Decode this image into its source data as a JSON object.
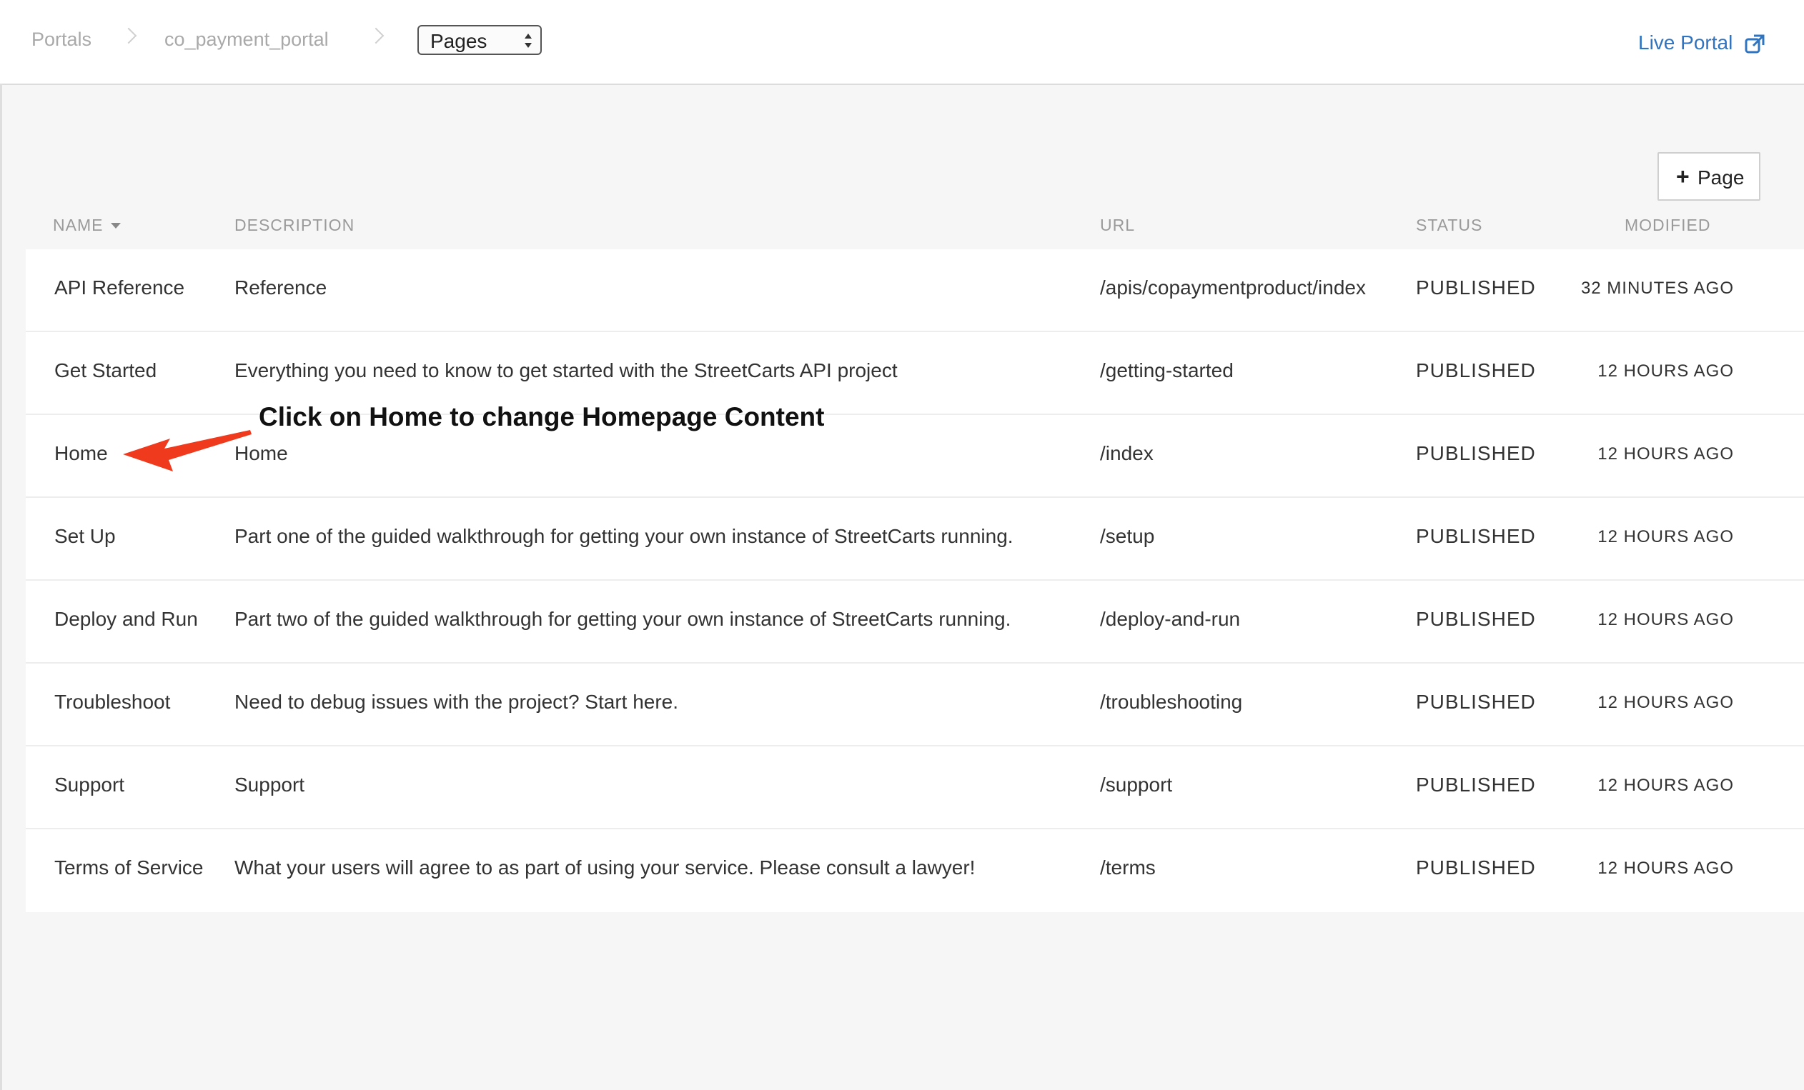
{
  "breadcrumb": {
    "portals": "Portals",
    "portal_name": "co_payment_portal",
    "section_select": "Pages"
  },
  "header": {
    "live_portal": "Live Portal"
  },
  "toolbar": {
    "add_page_label": "Page"
  },
  "table": {
    "headers": {
      "name": "NAME",
      "description": "DESCRIPTION",
      "url": "URL",
      "status": "STATUS",
      "modified": "MODIFIED"
    },
    "rows": [
      {
        "name": "API Reference",
        "description": "Reference",
        "url": "/apis/copaymentproduct/index",
        "status": "PUBLISHED",
        "modified": "32 MINUTES AGO"
      },
      {
        "name": "Get Started",
        "description": "Everything you need to know to get started with the StreetCarts API project",
        "url": "/getting-started",
        "status": "PUBLISHED",
        "modified": "12 HOURS AGO"
      },
      {
        "name": "Home",
        "description": "Home",
        "url": "/index",
        "status": "PUBLISHED",
        "modified": "12 HOURS AGO"
      },
      {
        "name": "Set Up",
        "description": "Part one of the guided walkthrough for getting your own instance of StreetCarts running.",
        "url": "/setup",
        "status": "PUBLISHED",
        "modified": "12 HOURS AGO"
      },
      {
        "name": "Deploy and Run",
        "description": "Part two of the guided walkthrough for getting your own instance of StreetCarts running.",
        "url": "/deploy-and-run",
        "status": "PUBLISHED",
        "modified": "12 HOURS AGO"
      },
      {
        "name": "Troubleshoot",
        "description": "Need to debug issues with the project? Start here.",
        "url": "/troubleshooting",
        "status": "PUBLISHED",
        "modified": "12 HOURS AGO"
      },
      {
        "name": "Support",
        "description": "Support",
        "url": "/support",
        "status": "PUBLISHED",
        "modified": "12 HOURS AGO"
      },
      {
        "name": "Terms of Service",
        "description": "What your users will agree to as part of using your service. Please consult a lawyer!",
        "url": "/terms",
        "status": "PUBLISHED",
        "modified": "12 HOURS AGO"
      }
    ]
  },
  "annotation": {
    "text": "Click on Home to change Homepage Content",
    "color": "#f03a1e"
  },
  "colors": {
    "link": "#2f74c0"
  }
}
